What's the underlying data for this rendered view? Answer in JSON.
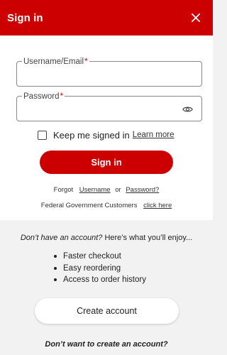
{
  "header": {
    "title": "Sign in",
    "close_icon": "close-icon"
  },
  "form": {
    "username_label": "Username/Email",
    "username_value": "",
    "password_label": "Password",
    "password_value": "",
    "required_mark": "*",
    "password_toggle_icon": "eye-icon",
    "keep_signed_in_label": "Keep me signed in",
    "keep_signed_in_checked": false,
    "learn_more": "Learn more",
    "signin_button": "Sign in"
  },
  "links": {
    "forgot_prefix": "Forgot",
    "forgot_username": "Username",
    "forgot_or": "or",
    "forgot_password": "Password?",
    "fed_text": "Federal Government Customers",
    "fed_link": "click here"
  },
  "create_section": {
    "prompt_italic": "Don’t have an account?",
    "prompt_rest": " Here’s what you’ll enjoy...",
    "benefits": [
      "Faster checkout",
      "Easy reordering",
      "Access to order history"
    ],
    "create_button": "Create account",
    "no_account_prompt": "Don’t want to create an account?"
  },
  "colors": {
    "brand_red": "#cc0000",
    "background": "#f2f2f2"
  }
}
